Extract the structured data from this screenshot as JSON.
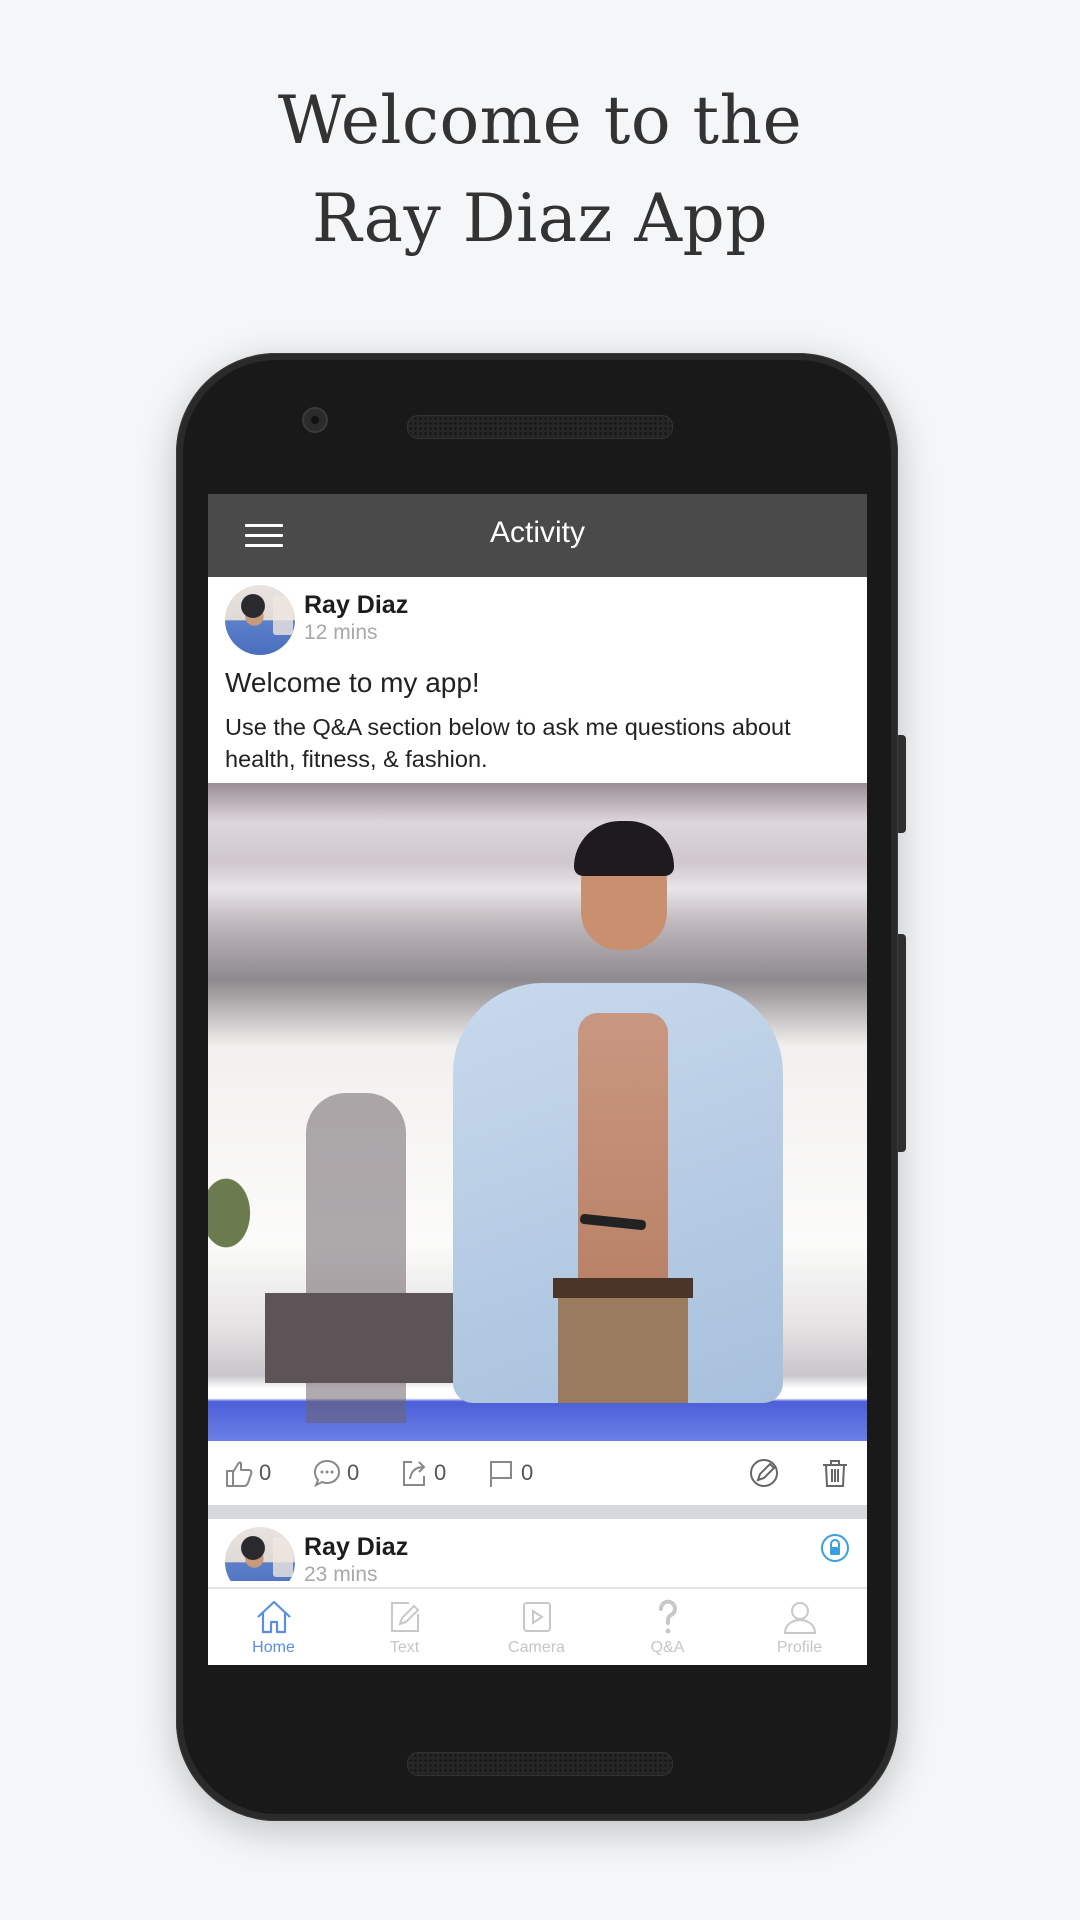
{
  "headline": {
    "line1": "Welcome to the",
    "line2": "Ray Diaz App"
  },
  "app": {
    "title": "Activity",
    "menu_icon": "hamburger-menu-icon",
    "accent_color": "#5b8de0",
    "appbar_color": "#4a4a4a"
  },
  "posts": [
    {
      "author": "Ray Diaz",
      "time": "12 mins",
      "title": "Welcome to my app!",
      "body": "Use the Q&A section below to ask me questions about health, fitness, & fashion.",
      "image": "photo of man in light denim shirt holding phone",
      "actions": {
        "likes": "0",
        "comments": "0",
        "shares": "0",
        "flags": "0"
      },
      "edit_icon": "edit-pencil-icon",
      "delete_icon": "trash-icon"
    },
    {
      "author": "Ray Diaz",
      "time": "23 mins",
      "lock_icon": "lock-icon"
    }
  ],
  "tabs": [
    {
      "label": "Home",
      "icon": "home-icon",
      "active": true
    },
    {
      "label": "Text",
      "icon": "pencil-square-icon",
      "active": false
    },
    {
      "label": "Camera",
      "icon": "play-square-icon",
      "active": false
    },
    {
      "label": "Q&A",
      "icon": "question-mark-icon",
      "active": false
    },
    {
      "label": "Profile",
      "icon": "person-icon",
      "active": false
    }
  ]
}
